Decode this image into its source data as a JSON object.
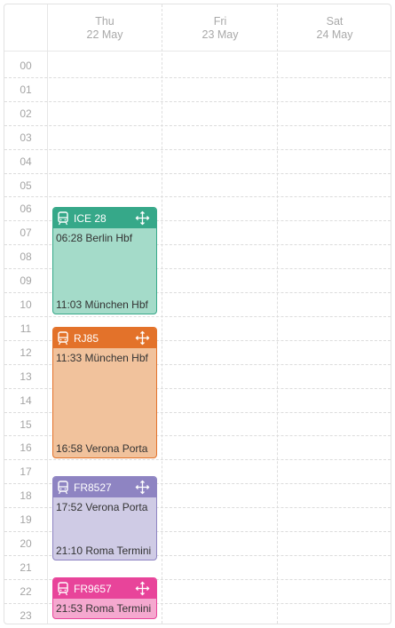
{
  "days": [
    {
      "name": "Thu",
      "date": "22 May"
    },
    {
      "name": "Fri",
      "date": "23 May"
    },
    {
      "name": "Sat",
      "date": "24 May"
    }
  ],
  "hours": [
    "00",
    "01",
    "02",
    "03",
    "04",
    "05",
    "06",
    "07",
    "08",
    "09",
    "10",
    "11",
    "12",
    "13",
    "14",
    "15",
    "16",
    "17",
    "18",
    "19",
    "20",
    "21",
    "22",
    "23"
  ],
  "events": [
    {
      "train": "ICE 28",
      "departure": "06:28 Berlin Hbf",
      "arrival": "11:03 München Hbf",
      "header_color": "#36a889",
      "body_color": "#a4dbc9",
      "border_color": "#36a889"
    },
    {
      "train": "RJ85",
      "departure": "11:33 München Hbf",
      "arrival": "16:58 Verona Porta",
      "header_color": "#e3722a",
      "body_color": "#f1c29c",
      "border_color": "#e3722a"
    },
    {
      "train": "FR8527",
      "departure": "17:52 Verona Porta",
      "arrival": "21:10 Roma Termini",
      "header_color": "#8e84c2",
      "body_color": "#cfcbe5",
      "border_color": "#8e84c2"
    },
    {
      "train": "FR9657",
      "departure": "21:53 Roma Termini",
      "arrival": "",
      "header_color": "#e8449a",
      "body_color": "#f5a8cf",
      "border_color": "#e8449a"
    }
  ]
}
